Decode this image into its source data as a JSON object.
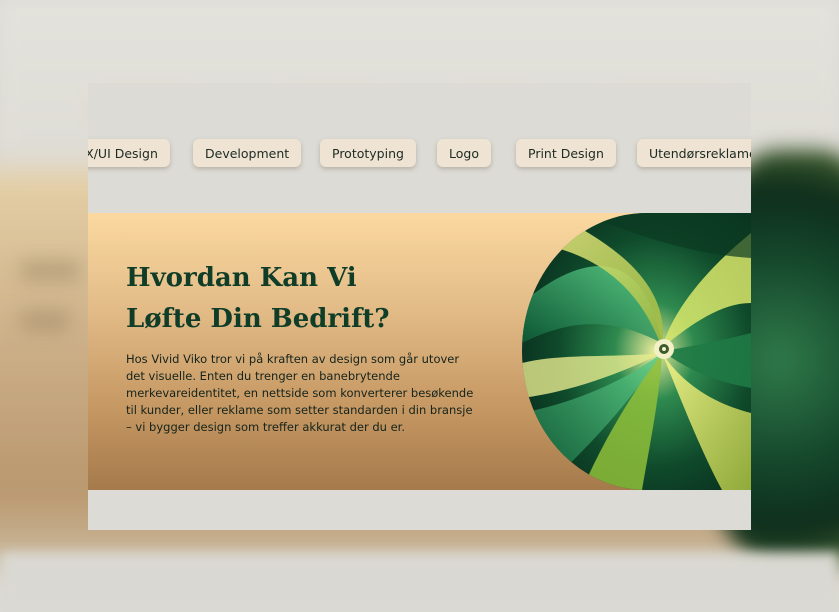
{
  "services": [
    {
      "label": "UX/UI Design"
    },
    {
      "label": "Development"
    },
    {
      "label": "Prototyping"
    },
    {
      "label": "Logo"
    },
    {
      "label": "Print Design"
    },
    {
      "label": "Utendørsreklame"
    }
  ],
  "hero": {
    "title_line1": "Hvordan Kan Vi",
    "title_line2": "Løfte Din Bedrift?",
    "body": "Hos Vivid Viko tror vi på kraften av design som går utover det visuelle. Enten du trenger en banebrytende merkevareidentitet, en nettside som konverterer besøkende til kunder, eller reklame som setter standarden i din bransje – vi bygger design som treffer akkurat der du er.",
    "image": "green-swirl-artwork"
  },
  "colors": {
    "title": "#0f3d28",
    "chip_bg": "#efe4d3",
    "hero_top": "#fbd9a0",
    "hero_bottom": "#a57a4b",
    "page_bg": "#dcdbd6"
  }
}
